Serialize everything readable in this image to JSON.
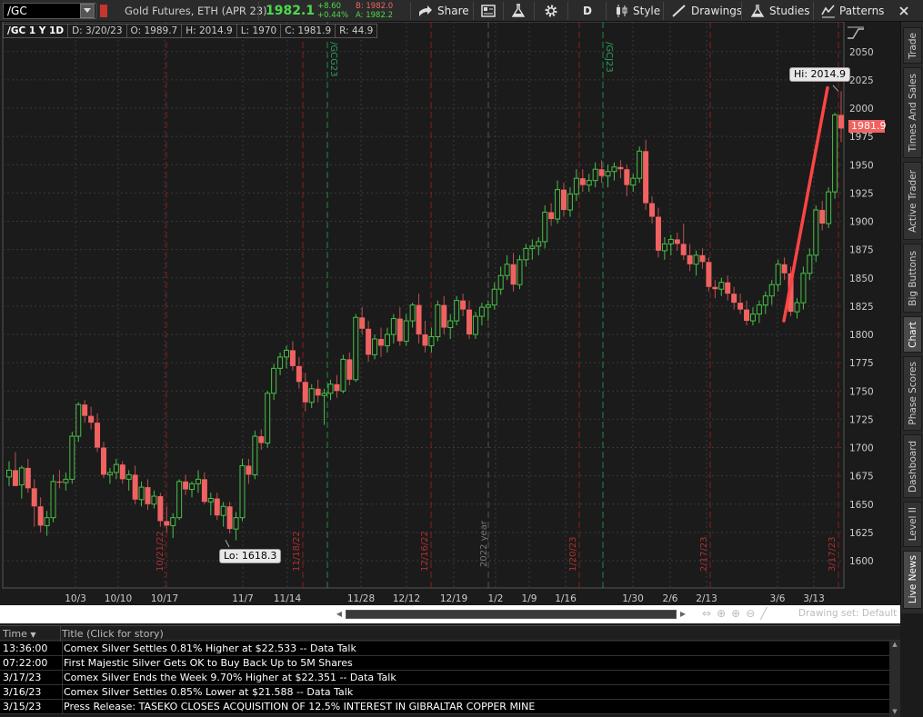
{
  "toolbar": {
    "symbol": "/GC",
    "description": "Gold Futures, ETH (APR 23)",
    "last": "1982.1",
    "change": "+8.60",
    "change_pct": "+0.44%",
    "bid": "B: 1982.0",
    "ask": "A: 1982.2",
    "share": "Share",
    "aggregation": "D",
    "style": "Style",
    "drawings": "Drawings",
    "studies": "Studies",
    "patterns": "Patterns"
  },
  "infobar": {
    "symbol": "/GC 1 Y 1D",
    "date": "D: 3/20/23",
    "open": "O: 1989.7",
    "high": "H: 2014.9",
    "low": "L: 1970",
    "close": "C: 1981.9",
    "range": "R: 44.9"
  },
  "chart_data": {
    "type": "candlestick",
    "y_ticks": [
      1600,
      1625,
      1650,
      1675,
      1700,
      1725,
      1750,
      1775,
      1800,
      1825,
      1850,
      1875,
      1900,
      1925,
      1950,
      1975,
      2000,
      2025,
      2050
    ],
    "x_labels": [
      "10/3",
      "10/10",
      "10/17",
      "11/7",
      "11/14",
      "11/28",
      "12/12",
      "12/19",
      "1/2",
      "1/9",
      "1/16",
      "1/30",
      "2/6",
      "2/13",
      "3/6",
      "3/13"
    ],
    "ylim": [
      1577,
      2065
    ],
    "grid": true,
    "expiry_markers": [
      "10/21/22",
      "11/18/22",
      "12/16/22",
      "1/20/23",
      "2/17/23",
      "3/17/23"
    ],
    "contract_markers": [
      "/GCG23",
      "/GCJ23"
    ],
    "year_marker": "2022 year",
    "hi_label": "Hi: 2014.9",
    "lo_label": "Lo: 1618.3",
    "last_price_label": "1981.9",
    "trend_line": {
      "from": [
        "3/6",
        1812
      ],
      "to": [
        "3/15",
        2018
      ],
      "color": "#ff4444"
    },
    "colors": {
      "up": "#48c048",
      "down": "#f06262",
      "grid": "#3a3a3a",
      "expiry": "#8a1e1e",
      "contract": "#1e8a4a"
    },
    "candles": [
      [
        1674,
        1688,
        1666,
        1680
      ],
      [
        1680,
        1696,
        1672,
        1666
      ],
      [
        1667,
        1684,
        1655,
        1682
      ],
      [
        1682,
        1690,
        1660,
        1664
      ],
      [
        1664,
        1672,
        1630,
        1648
      ],
      [
        1648,
        1656,
        1625,
        1631
      ],
      [
        1631,
        1644,
        1622,
        1638
      ],
      [
        1638,
        1676,
        1634,
        1670
      ],
      [
        1670,
        1680,
        1664,
        1669
      ],
      [
        1669,
        1678,
        1662,
        1672
      ],
      [
        1672,
        1714,
        1668,
        1710
      ],
      [
        1710,
        1740,
        1705,
        1738
      ],
      [
        1738,
        1742,
        1722,
        1728
      ],
      [
        1728,
        1736,
        1716,
        1722
      ],
      [
        1722,
        1730,
        1696,
        1700
      ],
      [
        1700,
        1705,
        1673,
        1676
      ],
      [
        1676,
        1682,
        1668,
        1678
      ],
      [
        1678,
        1690,
        1672,
        1685
      ],
      [
        1685,
        1688,
        1668,
        1672
      ],
      [
        1672,
        1680,
        1662,
        1676
      ],
      [
        1676,
        1684,
        1650,
        1654
      ],
      [
        1654,
        1670,
        1648,
        1665
      ],
      [
        1665,
        1672,
        1645,
        1650
      ],
      [
        1650,
        1662,
        1646,
        1657
      ],
      [
        1657,
        1660,
        1630,
        1635
      ],
      [
        1635,
        1648,
        1625,
        1631
      ],
      [
        1631,
        1642,
        1620,
        1638
      ],
      [
        1638,
        1672,
        1636,
        1670
      ],
      [
        1670,
        1676,
        1658,
        1663
      ],
      [
        1663,
        1670,
        1656,
        1668
      ],
      [
        1668,
        1680,
        1660,
        1672
      ],
      [
        1672,
        1678,
        1650,
        1652
      ],
      [
        1652,
        1660,
        1640,
        1655
      ],
      [
        1655,
        1660,
        1636,
        1640
      ],
      [
        1640,
        1652,
        1630,
        1648
      ],
      [
        1648,
        1652,
        1624,
        1628
      ],
      [
        1628,
        1643,
        1618,
        1638
      ],
      [
        1638,
        1690,
        1635,
        1684
      ],
      [
        1684,
        1690,
        1668,
        1676
      ],
      [
        1676,
        1715,
        1672,
        1710
      ],
      [
        1710,
        1716,
        1698,
        1704
      ],
      [
        1704,
        1750,
        1700,
        1748
      ],
      [
        1748,
        1774,
        1742,
        1770
      ],
      [
        1770,
        1784,
        1764,
        1780
      ],
      [
        1780,
        1790,
        1770,
        1786
      ],
      [
        1786,
        1794,
        1768,
        1772
      ],
      [
        1772,
        1780,
        1752,
        1758
      ],
      [
        1758,
        1766,
        1732,
        1740
      ],
      [
        1740,
        1756,
        1735,
        1752
      ],
      [
        1752,
        1760,
        1740,
        1746
      ],
      [
        1746,
        1752,
        1720,
        1748
      ],
      [
        1748,
        1760,
        1742,
        1756
      ],
      [
        1756,
        1764,
        1744,
        1750
      ],
      [
        1750,
        1782,
        1748,
        1778
      ],
      [
        1778,
        1784,
        1755,
        1760
      ],
      [
        1760,
        1818,
        1758,
        1815
      ],
      [
        1815,
        1824,
        1800,
        1805
      ],
      [
        1805,
        1812,
        1776,
        1782
      ],
      [
        1782,
        1800,
        1778,
        1796
      ],
      [
        1796,
        1806,
        1780,
        1790
      ],
      [
        1790,
        1806,
        1784,
        1800
      ],
      [
        1800,
        1818,
        1792,
        1814
      ],
      [
        1814,
        1824,
        1790,
        1794
      ],
      [
        1794,
        1818,
        1790,
        1812
      ],
      [
        1812,
        1828,
        1806,
        1826
      ],
      [
        1826,
        1836,
        1792,
        1800
      ],
      [
        1800,
        1812,
        1784,
        1790
      ],
      [
        1790,
        1806,
        1784,
        1798
      ],
      [
        1798,
        1830,
        1794,
        1826
      ],
      [
        1826,
        1834,
        1800,
        1806
      ],
      [
        1806,
        1818,
        1796,
        1812
      ],
      [
        1812,
        1834,
        1808,
        1830
      ],
      [
        1830,
        1836,
        1816,
        1822
      ],
      [
        1822,
        1830,
        1796,
        1800
      ],
      [
        1800,
        1820,
        1796,
        1816
      ],
      [
        1816,
        1828,
        1808,
        1824
      ],
      [
        1824,
        1830,
        1812,
        1826
      ],
      [
        1826,
        1846,
        1822,
        1840
      ],
      [
        1840,
        1860,
        1835,
        1852
      ],
      [
        1852,
        1870,
        1848,
        1862
      ],
      [
        1862,
        1872,
        1838,
        1844
      ],
      [
        1844,
        1870,
        1840,
        1866
      ],
      [
        1866,
        1880,
        1860,
        1876
      ],
      [
        1876,
        1884,
        1866,
        1878
      ],
      [
        1878,
        1886,
        1870,
        1882
      ],
      [
        1882,
        1914,
        1876,
        1908
      ],
      [
        1908,
        1916,
        1896,
        1902
      ],
      [
        1902,
        1936,
        1898,
        1928
      ],
      [
        1928,
        1934,
        1904,
        1910
      ],
      [
        1910,
        1930,
        1904,
        1924
      ],
      [
        1924,
        1946,
        1918,
        1938
      ],
      [
        1938,
        1946,
        1926,
        1932
      ],
      [
        1932,
        1942,
        1926,
        1936
      ],
      [
        1936,
        1952,
        1930,
        1946
      ],
      [
        1946,
        1954,
        1934,
        1940
      ],
      [
        1940,
        1950,
        1930,
        1944
      ],
      [
        1944,
        1952,
        1936,
        1948
      ],
      [
        1948,
        1954,
        1938,
        1946
      ],
      [
        1946,
        1950,
        1922,
        1932
      ],
      [
        1932,
        1942,
        1926,
        1938
      ],
      [
        1938,
        1966,
        1934,
        1962
      ],
      [
        1962,
        1972,
        1910,
        1916
      ],
      [
        1916,
        1922,
        1898,
        1904
      ],
      [
        1904,
        1912,
        1868,
        1874
      ],
      [
        1874,
        1886,
        1866,
        1880
      ],
      [
        1880,
        1888,
        1870,
        1884
      ],
      [
        1884,
        1890,
        1874,
        1880
      ],
      [
        1880,
        1898,
        1866,
        1870
      ],
      [
        1870,
        1880,
        1856,
        1862
      ],
      [
        1862,
        1874,
        1852,
        1870
      ],
      [
        1870,
        1876,
        1858,
        1864
      ],
      [
        1864,
        1868,
        1838,
        1842
      ],
      [
        1842,
        1848,
        1832,
        1840
      ],
      [
        1840,
        1850,
        1834,
        1846
      ],
      [
        1846,
        1852,
        1830,
        1836
      ],
      [
        1836,
        1842,
        1822,
        1828
      ],
      [
        1828,
        1836,
        1818,
        1822
      ],
      [
        1822,
        1830,
        1808,
        1812
      ],
      [
        1812,
        1824,
        1808,
        1818
      ],
      [
        1818,
        1830,
        1810,
        1826
      ],
      [
        1826,
        1838,
        1818,
        1834
      ],
      [
        1834,
        1848,
        1826,
        1844
      ],
      [
        1844,
        1866,
        1838,
        1862
      ],
      [
        1862,
        1868,
        1848,
        1854
      ],
      [
        1854,
        1860,
        1816,
        1820
      ],
      [
        1820,
        1832,
        1814,
        1828
      ],
      [
        1828,
        1860,
        1822,
        1854
      ],
      [
        1854,
        1876,
        1848,
        1870
      ],
      [
        1870,
        1914,
        1864,
        1910
      ],
      [
        1910,
        1918,
        1892,
        1898
      ],
      [
        1898,
        1930,
        1894,
        1926
      ],
      [
        1926,
        1996,
        1920,
        1994
      ],
      [
        1994,
        2015,
        1970,
        1982
      ]
    ]
  },
  "side_tabs": [
    "Trade",
    "Times And Sales",
    "Active Trader",
    "Big Buttons",
    "Chart",
    "Phase Scores",
    "Dashboard",
    "Level II",
    "Live News"
  ],
  "scrollbar": {
    "drawing_set": "Drawing set: Default"
  },
  "news": {
    "col_time": "Time",
    "col_title": "Title (Click for story)",
    "rows": [
      {
        "time": "13:36:00",
        "title": "Comex Silver Settles 0.81% Higher at $22.533 -- Data Talk"
      },
      {
        "time": "07:22:00",
        "title": "First Majestic Silver Gets OK to Buy Back Up to 5M Shares"
      },
      {
        "time": "3/17/23",
        "title": "Comex Silver Ends the Week 9.70% Higher at $22.351 -- Data Talk"
      },
      {
        "time": "3/16/23",
        "title": "Comex Silver Settles 0.85% Lower at $21.588 -- Data Talk"
      },
      {
        "time": "3/15/23",
        "title": "Press Release: TASEKO CLOSES ACQUISITION OF 12.5% INTEREST IN GIBRALTAR COPPER MINE"
      }
    ]
  }
}
